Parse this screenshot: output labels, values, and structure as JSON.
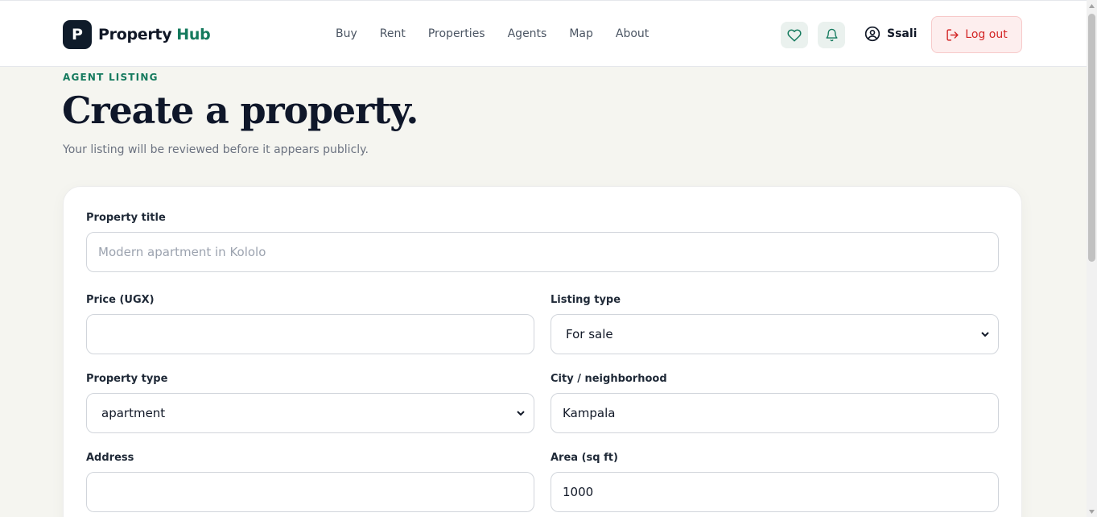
{
  "brand": {
    "mark": "P",
    "name": "Property",
    "accent": "Hub",
    "accent_color": "#157a5e"
  },
  "nav": [
    "Buy",
    "Rent",
    "Properties",
    "Agents",
    "Map",
    "About"
  ],
  "header_icons": [
    "heart-icon",
    "bell-icon"
  ],
  "user": {
    "name": "Ssali",
    "icon": "user-circle-icon"
  },
  "logout": {
    "label": "Log out",
    "icon": "logout-icon",
    "color": "#d32626"
  },
  "hero": {
    "eyebrow": "AGENT LISTING",
    "title": "Create a property.",
    "subtitle": "Your listing will be reviewed before it appears publicly."
  },
  "form": {
    "title": {
      "label": "Property title",
      "value": "",
      "placeholder": "Modern apartment in Kololo"
    },
    "price": {
      "label": "Price (UGX)",
      "value": ""
    },
    "listing_type": {
      "label": "Listing type",
      "value": "For sale"
    },
    "property_type": {
      "label": "Property type",
      "value": "apartment"
    },
    "city": {
      "label": "City / neighborhood",
      "value": "Kampala"
    },
    "address": {
      "label": "Address",
      "value": ""
    },
    "area": {
      "label": "Area (sq ft)",
      "value": "1000"
    }
  }
}
